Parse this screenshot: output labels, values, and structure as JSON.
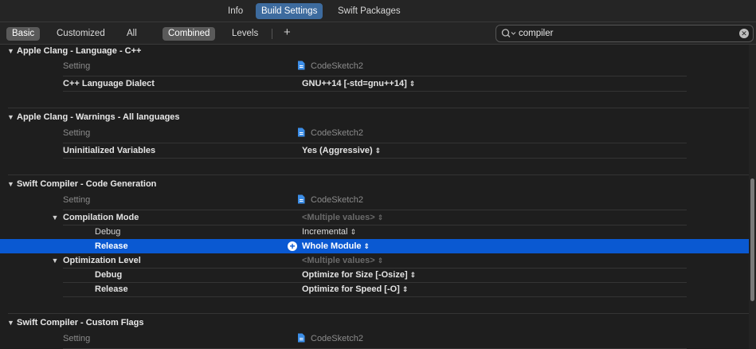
{
  "tabs": [
    {
      "label": "Info",
      "active": false
    },
    {
      "label": "Build Settings",
      "active": true
    },
    {
      "label": "Swift Packages",
      "active": false
    }
  ],
  "filters": {
    "level": [
      "Basic",
      "Customized",
      "All"
    ],
    "level_selected": "Basic",
    "view": [
      "Combined",
      "Levels"
    ],
    "view_selected": "Combined",
    "add_symbol": "+"
  },
  "search": {
    "value": "compiler"
  },
  "column_label_setting": "Setting",
  "target_name": "CodeSketch2",
  "sections": [
    {
      "title": "Apple Clang - Language - C++",
      "rows": [
        {
          "name": "C++ Language Dialect",
          "value": "GNU++14 [-std=gnu++14]"
        }
      ]
    },
    {
      "title": "Apple Clang - Warnings - All languages",
      "rows": [
        {
          "name": "Uninitialized Variables",
          "value": "Yes (Aggressive)"
        }
      ]
    },
    {
      "title": "Swift Compiler - Code Generation",
      "rows": [
        {
          "name": "Compilation Mode",
          "value": "<Multiple values>"
        },
        {
          "name": "Debug",
          "value": "Incremental"
        },
        {
          "name": "Release",
          "value": "Whole Module"
        },
        {
          "name": "Optimization Level",
          "value": "<Multiple values>"
        },
        {
          "name": "Debug",
          "value": "Optimize for Size [-Osize]"
        },
        {
          "name": "Release",
          "value": "Optimize for Speed [-O]"
        }
      ]
    },
    {
      "title": "Swift Compiler - Custom Flags",
      "rows": []
    }
  ],
  "colors": {
    "selection": "#0a59d2",
    "active_tab": "#3d6b9e",
    "background": "#1e1e1e"
  }
}
